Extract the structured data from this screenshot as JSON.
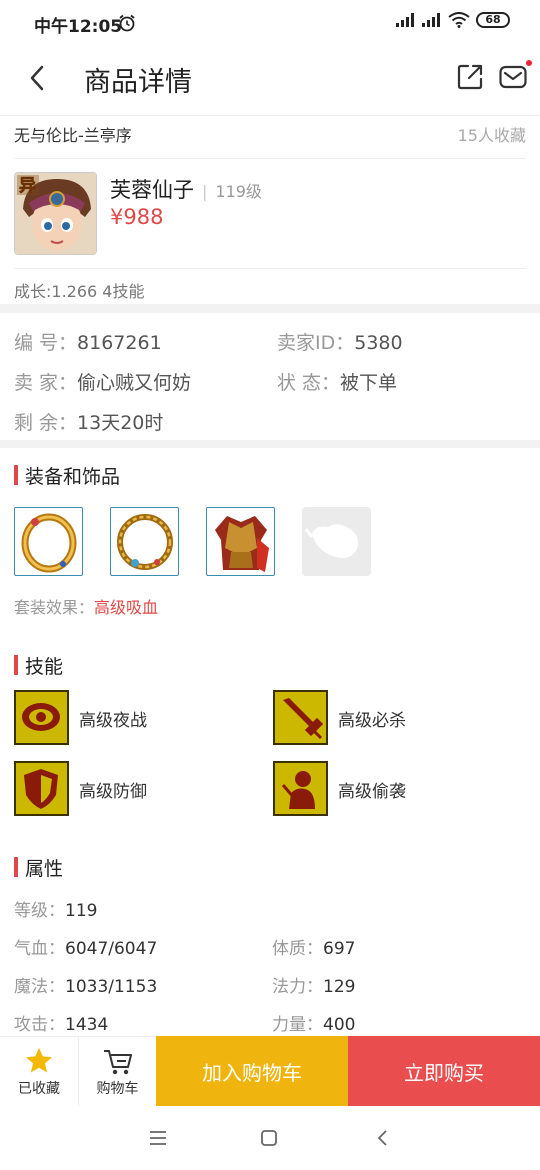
{
  "status_bar": {
    "time": "中午12:05",
    "battery": "68"
  },
  "nav": {
    "title": "商品详情"
  },
  "seller_header": {
    "server": "无与伦比-兰亭序",
    "favorites": "15人收藏"
  },
  "pet": {
    "name": "芙蓉仙子",
    "level": "119级",
    "price": "¥988",
    "badge": "异",
    "growth": "成长:1.266 4技能"
  },
  "info": {
    "id_label": "编  号：",
    "id": "8167261",
    "seller_id_label": "卖家ID：",
    "seller_id": "5380",
    "seller_label": "卖  家：",
    "seller": "偷心贼又何妨",
    "status_label": "状  态：",
    "status": "被下单",
    "remaining_label": "剩  余：",
    "remaining": "13天20时"
  },
  "equipment": {
    "title": "装备和饰品",
    "items": [
      "ring-gold",
      "necklace-gold",
      "armor-red",
      "empty-slot"
    ],
    "set_label": "套装效果：",
    "set_value": "高级吸血"
  },
  "skills": {
    "title": "技能",
    "items": [
      {
        "name": "高级夜战",
        "icon": "eye-icon"
      },
      {
        "name": "高级必杀",
        "icon": "sword-icon"
      },
      {
        "name": "高级防御",
        "icon": "shield-icon"
      },
      {
        "name": "高级偷袭",
        "icon": "sneak-icon"
      }
    ]
  },
  "attributes": {
    "title": "属性",
    "level_label": "等级：",
    "level": "119",
    "hp_label": "气血：",
    "hp": "6047/6047",
    "con_label": "体质：",
    "con": "697",
    "mp_label": "魔法：",
    "mp": "1033/1153",
    "mag_label": "法力：",
    "mag": "129",
    "atk_label": "攻击：",
    "atk": "1434",
    "str_label": "力量：",
    "str": "400"
  },
  "bottom_bar": {
    "favorited": "已收藏",
    "cart": "购物车",
    "add_to_cart": "加入购物车",
    "buy_now": "立即购买"
  },
  "colors": {
    "accent_red": "#e04848",
    "cart_yellow": "#f0b40f",
    "buy_red": "#ea4d4d"
  }
}
